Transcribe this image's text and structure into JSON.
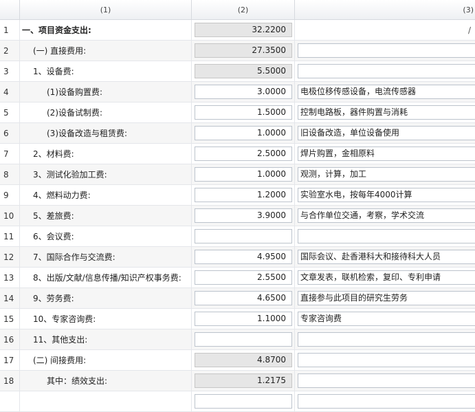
{
  "headers": [
    "(1)",
    "(2)",
    "(3)"
  ],
  "rows": [
    {
      "idx": "1",
      "label": "一、项目资金支出:",
      "amount": "32.2200",
      "note": "/",
      "readonly": true,
      "level": 0,
      "bold": true,
      "has_note_input": false
    },
    {
      "idx": "2",
      "label": "(一) 直接费用:",
      "amount": "27.3500",
      "note": "",
      "readonly": true,
      "level": 1,
      "has_note_input": true
    },
    {
      "idx": "3",
      "label": "1、设备费:",
      "amount": "5.5000",
      "note": "",
      "readonly": true,
      "level": 2,
      "has_note_input": true
    },
    {
      "idx": "4",
      "label": "(1)设备购置费:",
      "amount": "3.0000",
      "note": "电极位移传感设备，电流传感器",
      "readonly": false,
      "level": 3,
      "has_note_input": true
    },
    {
      "idx": "5",
      "label": "(2)设备试制费:",
      "amount": "1.5000",
      "note": "控制电路板，器件购置与消耗",
      "readonly": false,
      "level": 3,
      "has_note_input": true
    },
    {
      "idx": "6",
      "label": "(3)设备改造与租赁费:",
      "amount": "1.0000",
      "note": "旧设备改造，单位设备使用",
      "readonly": false,
      "level": 3,
      "has_note_input": true
    },
    {
      "idx": "7",
      "label": "2、材料费:",
      "amount": "2.5000",
      "note": "焊片购置，金相原料",
      "readonly": false,
      "level": 2,
      "has_note_input": true
    },
    {
      "idx": "8",
      "label": "3、测试化验加工费:",
      "amount": "1.0000",
      "note": "观测，计算，加工",
      "readonly": false,
      "level": 2,
      "has_note_input": true
    },
    {
      "idx": "9",
      "label": "4、燃料动力费:",
      "amount": "1.2000",
      "note": "实验室水电，按每年4000计算",
      "readonly": false,
      "level": 2,
      "has_note_input": true
    },
    {
      "idx": "10",
      "label": "5、差旅费:",
      "amount": "3.9000",
      "note": "与合作单位交通，考察，学术交流",
      "readonly": false,
      "level": 2,
      "has_note_input": true
    },
    {
      "idx": "11",
      "label": "6、会议费:",
      "amount": "",
      "note": "",
      "readonly": false,
      "level": 2,
      "has_note_input": true
    },
    {
      "idx": "12",
      "label": "7、国际合作与交流费:",
      "amount": "4.9500",
      "note": "国际会议、赴香港科大和接待科大人员",
      "readonly": false,
      "level": 2,
      "has_note_input": true
    },
    {
      "idx": "13",
      "label": "8、出版/文献/信息传播/知识产权事务费:",
      "amount": "2.5500",
      "note": "文章发表，联机检索，复印、专利申请",
      "readonly": false,
      "level": 2,
      "has_note_input": true
    },
    {
      "idx": "14",
      "label": "9、劳务费:",
      "amount": "4.6500",
      "note": "直接参与此项目的研究生劳务",
      "readonly": false,
      "level": 2,
      "has_note_input": true
    },
    {
      "idx": "15",
      "label": "10、专家咨询费:",
      "amount": "1.1000",
      "note": "专家咨询费",
      "readonly": false,
      "level": 2,
      "has_note_input": true
    },
    {
      "idx": "16",
      "label": "11、其他支出:",
      "amount": "",
      "note": "",
      "readonly": false,
      "level": 2,
      "has_note_input": true
    },
    {
      "idx": "17",
      "label": "(二) 间接费用:",
      "amount": "4.8700",
      "note": "",
      "readonly": true,
      "level": 1,
      "has_note_input": true
    },
    {
      "idx": "18",
      "label": "其中：绩效支出:",
      "amount": "1.2175",
      "note": "",
      "readonly": true,
      "level": 3,
      "has_note_input": true
    },
    {
      "idx": "",
      "label": "",
      "amount": "",
      "note": "",
      "readonly": false,
      "level": 2,
      "has_note_input": true
    }
  ],
  "colors": {
    "readonly_bg": "#e6e6e6",
    "alt_row_bg": "#f6f6f6",
    "border": "#bcc3cc"
  }
}
